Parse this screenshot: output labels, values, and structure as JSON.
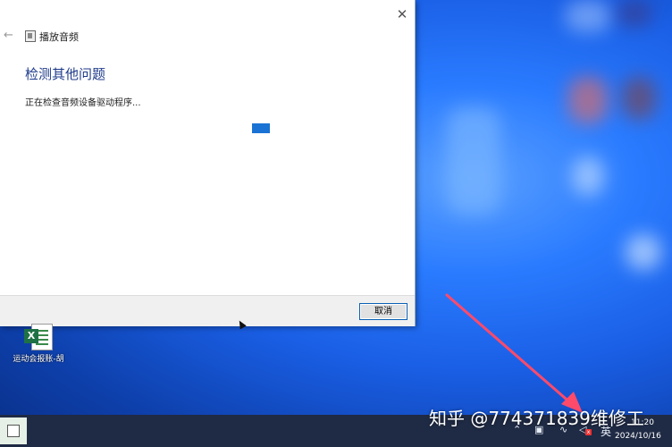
{
  "dialog": {
    "app_title": "播放音频",
    "heading": "检测其他问题",
    "status": "正在检查音频设备驱动程序...",
    "cancel_label": "取消"
  },
  "desktop": {
    "icon_label": "运动会报账-胡"
  },
  "taskbar": {
    "ime": "英",
    "time": "11:20",
    "date": "2024/10/16"
  },
  "watermark": "知乎 @774371839维修工",
  "colors": {
    "accent": "#1a73d4",
    "heading": "#1e3a8a",
    "taskbar": "#1f2a44",
    "annotation_arrow": "#ff4a6a"
  }
}
